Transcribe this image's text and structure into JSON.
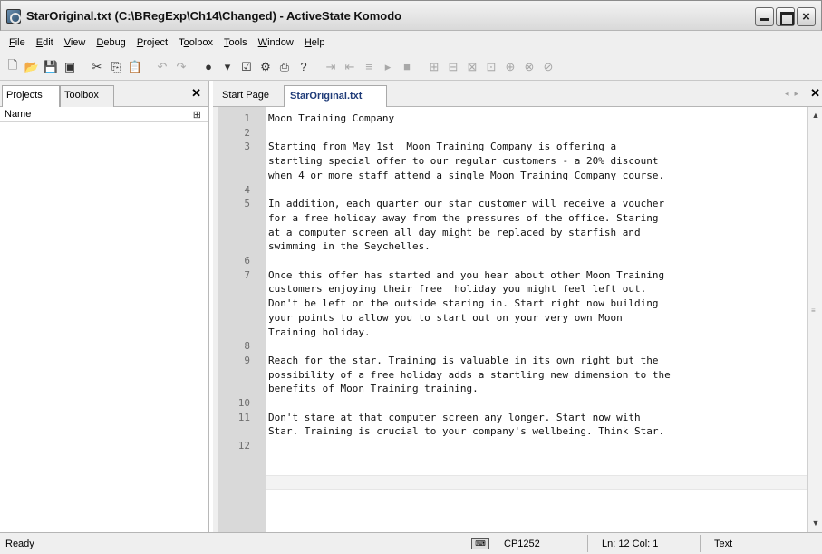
{
  "window": {
    "title": "StarOriginal.txt (C:\\BRegExp\\Ch14\\Changed) - ActiveState Komodo"
  },
  "menubar": {
    "items": [
      "File",
      "Edit",
      "View",
      "Debug",
      "Project",
      "Toolbox",
      "Tools",
      "Window",
      "Help"
    ],
    "accesskeys": [
      "F",
      "E",
      "V",
      "D",
      "P",
      "o",
      "T",
      "W",
      "H"
    ]
  },
  "left_panel": {
    "tabs": [
      "Projects",
      "Toolbox"
    ],
    "column_header": "Name"
  },
  "editor": {
    "tabs": [
      "Start Page",
      "StarOriginal.txt"
    ],
    "line_numbers": [
      "1",
      "2",
      "3",
      "",
      "",
      "4",
      "5",
      "",
      "",
      "",
      "6",
      "7",
      "",
      "",
      "",
      "",
      "8",
      "9",
      "",
      "",
      "10",
      "11",
      "",
      "12"
    ],
    "lines": [
      "Moon Training Company",
      "",
      "Starting from May 1st  Moon Training Company is offering a",
      "startling special offer to our regular customers - a 20% discount",
      "when 4 or more staff attend a single Moon Training Company course.",
      "",
      "In addition, each quarter our star customer will receive a voucher",
      "for a free holiday away from the pressures of the office. Staring",
      "at a computer screen all day might be replaced by starfish and",
      "swimming in the Seychelles.",
      "",
      "Once this offer has started and you hear about other Moon Training",
      "customers enjoying their free  holiday you might feel left out.",
      "Don't be left on the outside staring in. Start right now building",
      "your points to allow you to start out on your very own Moon",
      "Training holiday.",
      "",
      "Reach for the star. Training is valuable in its own right but the",
      "possibility of a free holiday adds a startling new dimension to the",
      "benefits of Moon Training training.",
      "",
      "Don't stare at that computer screen any longer. Start now with",
      "Star. Training is crucial to your company's wellbeing. Think Star.",
      ""
    ]
  },
  "statusbar": {
    "status": "Ready",
    "encoding": "CP1252",
    "position": "Ln: 12 Col: 1",
    "language": "Text"
  },
  "colors": {
    "active_tab_text": "#1f3b78",
    "gutter": "#d9d9d9",
    "chrome": "#efefef"
  }
}
